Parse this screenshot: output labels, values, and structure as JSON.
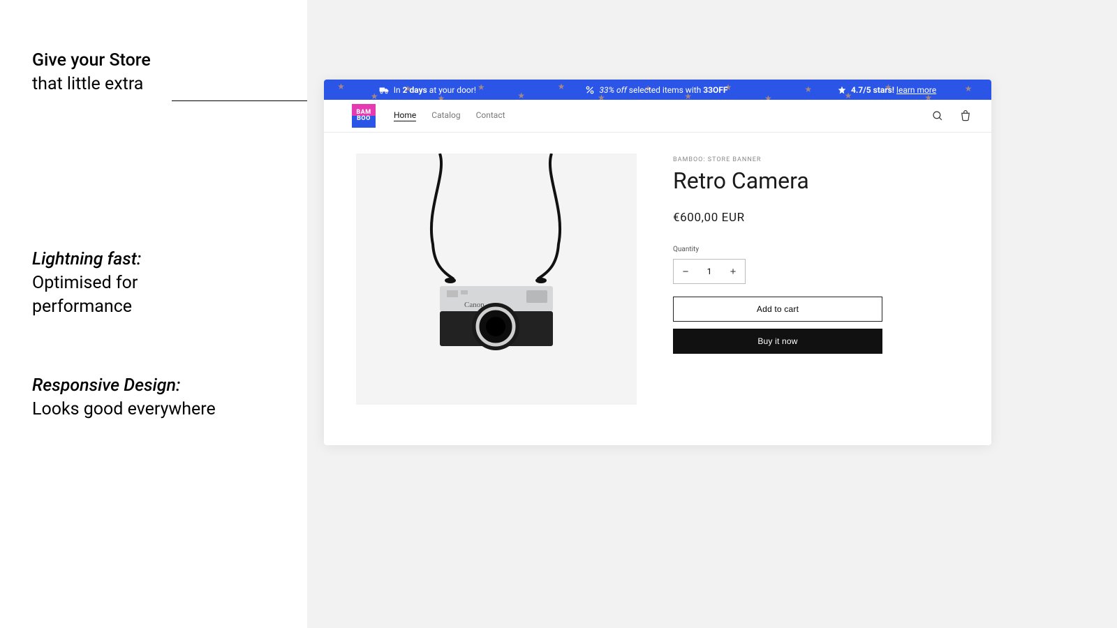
{
  "features": {
    "f1_line1": "Give your Store",
    "f1_line2": "that little extra",
    "f2_head": "Lightning fast:",
    "f2_line1": "Optimised for",
    "f2_line2": "performance",
    "f3_head": "Responsive Design:",
    "f3_line1": "Looks good everywhere"
  },
  "banner": {
    "delivery_pre": "In ",
    "delivery_days": "2 days",
    "delivery_post": " at your door!",
    "discount_pct": "33% off",
    "discount_mid": " selected items with ",
    "discount_code": "33OFF",
    "rating_text": "4.7/5 stars! ",
    "rating_link": "learn more"
  },
  "brand": {
    "l1": "BAM",
    "l2": "BOO"
  },
  "nav": {
    "home": "Home",
    "catalog": "Catalog",
    "contact": "Contact"
  },
  "product": {
    "vendor": "BAMBOO: STORE BANNER",
    "title": "Retro Camera",
    "price": "€600,00 EUR",
    "qty_label": "Quantity",
    "qty": "1",
    "add_to_cart": "Add to cart",
    "buy_now": "Buy it now"
  }
}
